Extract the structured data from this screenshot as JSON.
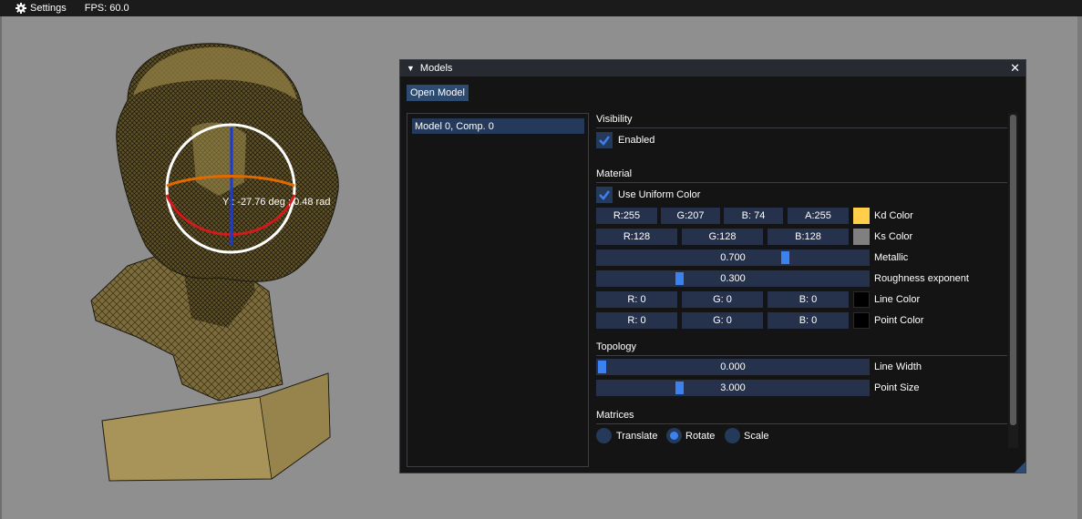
{
  "menubar": {
    "settings_label": "Settings",
    "settings_icon": "gear-icon",
    "fps": "FPS: 60.0"
  },
  "viewport": {
    "gizmo_text": "Y : -27.76 deg ; 0.48 rad",
    "colors": {
      "background": "#8f8f8f",
      "mesh": "#7a6a3a",
      "gizmo_ring": "#ffffff",
      "axis_x": "#d21a1a",
      "axis_y": "#1a3ad2",
      "axis_z": "#e06a00"
    }
  },
  "window": {
    "title": "Models",
    "close_symbol": "✕",
    "collapse_symbol": "▼",
    "open_model_label": "Open Model",
    "models": [
      "Model 0, Comp. 0"
    ]
  },
  "visibility": {
    "header": "Visibility",
    "enabled_label": "Enabled",
    "enabled": true
  },
  "material": {
    "header": "Material",
    "use_uniform_label": "Use Uniform Color",
    "use_uniform": true,
    "kd": {
      "r": "R:255",
      "g": "G:207",
      "b": "B: 74",
      "a": "A:255",
      "label": "Kd Color",
      "swatch": "#ffcf4a"
    },
    "ks": {
      "r": "R:128",
      "g": "G:128",
      "b": "B:128",
      "label": "Ks Color",
      "swatch": "#808080"
    },
    "metallic": {
      "value_text": "0.700",
      "value": 0.7,
      "label": "Metallic"
    },
    "roughness": {
      "value_text": "0.300",
      "value": 0.3,
      "label": "Roughness exponent"
    },
    "line_color": {
      "r": "R: 0",
      "g": "G: 0",
      "b": "B: 0",
      "label": "Line Color",
      "swatch": "#000000"
    },
    "point_color": {
      "r": "R: 0",
      "g": "G: 0",
      "b": "B: 0",
      "label": "Point Color",
      "swatch": "#000000"
    }
  },
  "topology": {
    "header": "Topology",
    "line_width": {
      "value_text": "0.000",
      "value": 0.0,
      "label": "Line Width"
    },
    "point_size": {
      "value_text": "3.000",
      "value": 0.3,
      "label": "Point Size"
    }
  },
  "matrices": {
    "header": "Matrices",
    "options": [
      "Translate",
      "Rotate",
      "Scale"
    ],
    "selected": "Rotate"
  }
}
